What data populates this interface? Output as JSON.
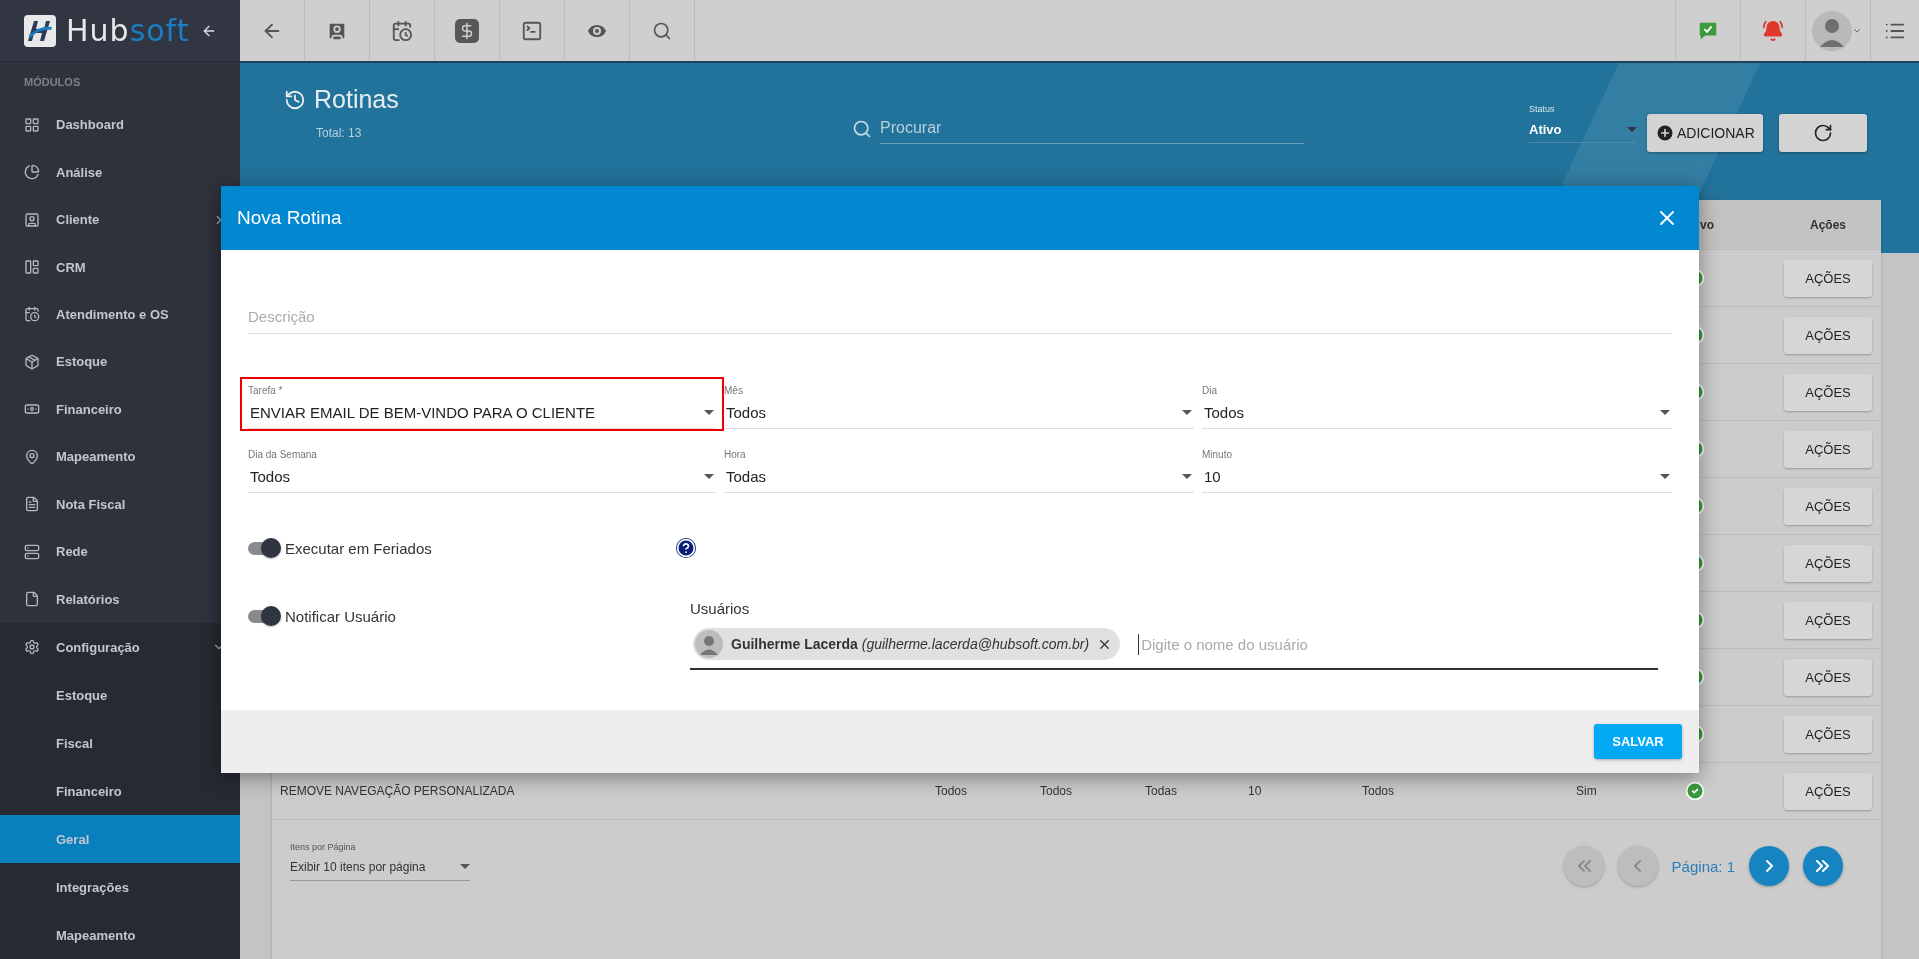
{
  "logo": {
    "text": "Hub",
    "accent": "soft"
  },
  "sidebar": {
    "section": "MÓDULOS",
    "items": [
      {
        "label": "Dashboard",
        "selected": false
      },
      {
        "label": "Análise",
        "selected": false
      },
      {
        "label": "Cliente",
        "selected": false,
        "expanded": false
      },
      {
        "label": "CRM",
        "selected": false
      },
      {
        "label": "Atendimento e OS",
        "selected": false
      },
      {
        "label": "Estoque",
        "selected": false
      },
      {
        "label": "Financeiro",
        "selected": false
      },
      {
        "label": "Mapeamento",
        "selected": false
      },
      {
        "label": "Nota Fiscal",
        "selected": false
      },
      {
        "label": "Rede",
        "selected": false
      },
      {
        "label": "Relatórios",
        "selected": false
      },
      {
        "label": "Configuração",
        "selected": false,
        "expanded": true,
        "children": [
          {
            "label": "Estoque",
            "selected": false
          },
          {
            "label": "Fiscal",
            "selected": false
          },
          {
            "label": "Financeiro",
            "selected": false
          },
          {
            "label": "Geral",
            "selected": true
          },
          {
            "label": "Integrações",
            "selected": false
          },
          {
            "label": "Mapeamento",
            "selected": false
          }
        ]
      }
    ]
  },
  "page": {
    "title": "Rotinas",
    "total": "Total: 13",
    "search": {
      "placeholder": "Procurar"
    },
    "status": {
      "label": "Status",
      "value": "Ativo"
    },
    "add_button": "ADICIONAR"
  },
  "table": {
    "columns": [
      "vo",
      "Ações"
    ],
    "rows": [
      {
        "active": true,
        "action": "AÇÕES"
      },
      {
        "active": true,
        "action": "AÇÕES"
      },
      {
        "active": true,
        "action": "AÇÕES"
      },
      {
        "active": true,
        "action": "AÇÕES"
      },
      {
        "active": true,
        "action": "AÇÕES"
      },
      {
        "active": true,
        "action": "AÇÕES"
      },
      {
        "active": true,
        "action": "AÇÕES"
      },
      {
        "active": true,
        "action": "AÇÕES"
      },
      {
        "active": true,
        "action": "AÇÕES"
      },
      {
        "cells": [
          "REMOVE NAVEGAÇÃO PERSONALIZADA",
          "Todos",
          "Todos",
          "Todas",
          "10",
          "Todos",
          "Sim"
        ],
        "active": true,
        "action": "AÇÕES"
      }
    ]
  },
  "footer": {
    "items_per_page": {
      "label": "Itens por Página",
      "value": "Exibir 10 itens por página"
    },
    "page_label": "Página: 1",
    "pager": [
      {
        "kind": "first",
        "disabled": true
      },
      {
        "kind": "prev",
        "disabled": true
      },
      {
        "kind": "next",
        "disabled": false
      },
      {
        "kind": "last",
        "disabled": false
      }
    ]
  },
  "modal": {
    "title": "Nova Rotina",
    "description": {
      "placeholder": "Descrição"
    },
    "selects": [
      {
        "label": "Tarefa *",
        "value": "ENVIAR EMAIL DE BEM-VINDO PARA O CLIENTE",
        "highlighted": true
      },
      {
        "label": "Mês",
        "value": "Todos",
        "highlighted": false
      },
      {
        "label": "Dia",
        "value": "Todos",
        "highlighted": false
      },
      {
        "label": "Dia da Semana",
        "value": "Todos",
        "highlighted": false
      },
      {
        "label": "Hora",
        "value": "Todas",
        "highlighted": false
      },
      {
        "label": "Minuto",
        "value": "10",
        "highlighted": false
      }
    ],
    "toggles": [
      {
        "label": "Executar em Feriados",
        "on": true,
        "help": true
      },
      {
        "label": "Notificar Usuário",
        "on": true
      }
    ],
    "users": {
      "label": "Usuários",
      "chips": [
        "**Guilherme Lacerda** *(guilherme.lacerda@hubsoft.com.br)*"
      ],
      "placeholder": "Digite o nome do usuário"
    },
    "save_button": "SALVAR"
  }
}
